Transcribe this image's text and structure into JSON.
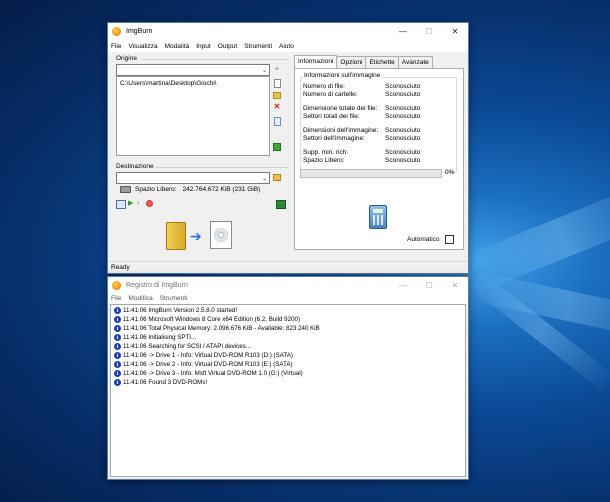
{
  "colors": {
    "desktop_blue": "#0b4a96",
    "window_border": "#5a7aa8",
    "progress_green": "#06b025",
    "info_icon": "#1a3fa8",
    "delete_red": "#d02020"
  },
  "main_window": {
    "title": "ImgBurn",
    "buttons": {
      "minimize": "—",
      "maximize": "☐",
      "close": "✕"
    },
    "menu": [
      "File",
      "Visualizza",
      "Modalità",
      "Input",
      "Output",
      "Strumenti",
      "Aiuto"
    ],
    "origine_label": "Origine",
    "origine_path": "C:\\Users\\martina\\Desktop\\Giochi\\",
    "destinazione_label": "Destinazione",
    "free_space_label": "Spazio Libero:",
    "free_space_value": "242.764.672 KiB (231 GiB)",
    "tabs": [
      "Informazioni",
      "Opzioni",
      "Etichette",
      "Avanzate"
    ],
    "active_tab": "Informazioni",
    "info_legend": "Informazioni sull'immagine",
    "info_rows": [
      {
        "label": "Numero di file:",
        "value": "Sconosciuto"
      },
      {
        "label": "Numero di cartelle:",
        "value": "Sconosciuto"
      },
      {
        "label": "Dimensione totale dei file:",
        "value": "Sconosciuto"
      },
      {
        "label": "Settori totali dei file:",
        "value": "Sconosciuto"
      },
      {
        "label": "Dimensioni dell'immagine:",
        "value": "Sconosciuto"
      },
      {
        "label": "Settori dell'immagine:",
        "value": "Sconosciuto"
      },
      {
        "label": "Supp. min. rich:",
        "value": "Sconosciuto"
      },
      {
        "label": "Spazio Libero:",
        "value": "Sconosciuto"
      }
    ],
    "progress_percent": 0,
    "progress_text": "0%",
    "automatico_label": "Automatico",
    "status": "Ready"
  },
  "log_window": {
    "title": "Registro di ImgBurn",
    "buttons": {
      "minimize": "—",
      "maximize": "☐",
      "close": "✕"
    },
    "menu": [
      "File",
      "Modifica",
      "Strumenti"
    ],
    "lines": [
      "11:41:06 ImgBurn Version 2.5.8.0 started!",
      "11:41:06 Microsoft Windows 8 Core x64 Edition (6.2, Build 9200)",
      "11:41:06 Total Physical Memory: 2.096.676 KiB  -  Available: 823.240 KiB",
      "11:41:06 Initialising SPTI...",
      "11:41:06 Searching for SCSI / ATAPI devices...",
      "11:41:06 -> Drive 1 - Info: Virtual DVD-ROM R103 (D:) (SATA)",
      "11:41:06 -> Drive 2 - Info: Virtual DVD-ROM R103 (E:) (SATA)",
      "11:41:06 -> Drive 3 - Info: Msft Virtual DVD-ROM 1.0 (G:) (Virtual)",
      "11:41:06 Found 3 DVD-ROMs!"
    ]
  }
}
